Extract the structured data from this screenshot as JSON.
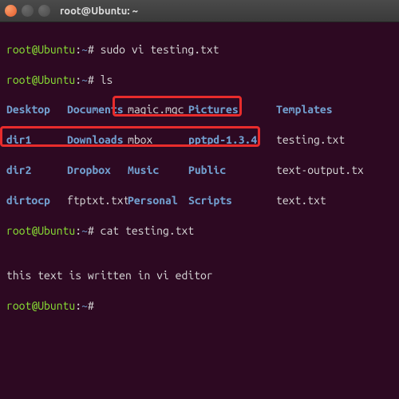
{
  "window": {
    "title": "root@Ubuntu: ~"
  },
  "prompt": {
    "user_host": "root@Ubuntu",
    "path": "~",
    "sep1": ":",
    "sep2": "#"
  },
  "cmds": {
    "c1": " sudo vi testing.txt",
    "c2": " ls",
    "c3": " cat testing.txt",
    "c4": ""
  },
  "ls": {
    "row1": {
      "a": "Desktop",
      "b": "Documents",
      "c": "magic.mgc",
      "d": "Pictures",
      "e": "Templates"
    },
    "row2": {
      "a": "dir1",
      "b": "Downloads",
      "c": "mbox",
      "d": "pptpd-1.3.4",
      "e": "testing.txt"
    },
    "row3": {
      "a": "dir2",
      "b": "Dropbox",
      "c": "Music",
      "d": "Public",
      "e": "text-output.tx"
    },
    "row4": {
      "a": "dirtocp",
      "b": "ftptxt.txt",
      "c": "Personal",
      "d": "Scripts",
      "e": "text.txt"
    }
  },
  "output": {
    "blank": "",
    "line": "this text is written in vi editor"
  },
  "icons": {
    "close": "close-icon",
    "min": "minimize-icon",
    "max": "maximize-icon"
  }
}
